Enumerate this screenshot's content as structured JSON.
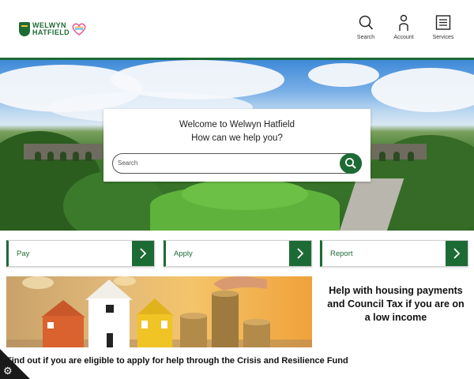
{
  "header": {
    "logo_line1": "WELWYN",
    "logo_line2": "HATFIELD",
    "nav": [
      {
        "label": "Search",
        "icon": "search-icon"
      },
      {
        "label": "Account",
        "icon": "account-icon"
      },
      {
        "label": "Services",
        "icon": "services-icon"
      }
    ]
  },
  "hero": {
    "welcome_line1": "Welcome to Welwyn Hatfield",
    "welcome_line2": "How can we help you?",
    "search_placeholder": "Search"
  },
  "actions": [
    {
      "label": "Pay"
    },
    {
      "label": "Apply"
    },
    {
      "label": "Report"
    }
  ],
  "promo": {
    "heading": "Help with housing payments and Council Tax if you are on a low income",
    "link": "Find out if you are eligible to apply for help through the Crisis and Resilience Fund"
  },
  "colors": {
    "brand_green": "#1d6b34",
    "cookie_badge": "#1a1a1a"
  }
}
